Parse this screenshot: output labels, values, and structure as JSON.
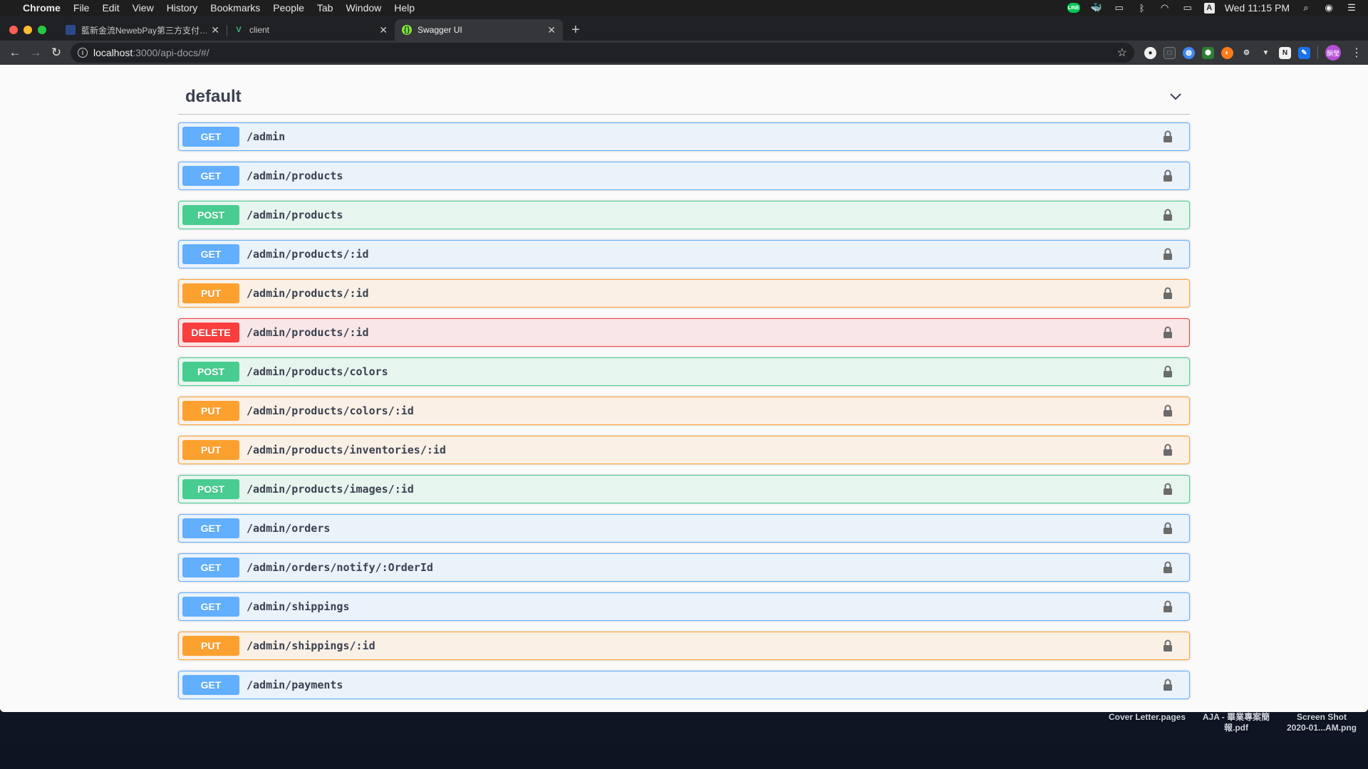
{
  "menubar": {
    "app": "Chrome",
    "items": [
      "File",
      "Edit",
      "View",
      "History",
      "Bookmarks",
      "People",
      "Tab",
      "Window",
      "Help"
    ],
    "clock": "Wed 11:15 PM",
    "line_badge": "LINE",
    "input_source": "A"
  },
  "browser": {
    "tabs": [
      {
        "title": "藍新金流NewebPay第三方支付…",
        "favicon": "bank-icon",
        "active": false
      },
      {
        "title": "client",
        "favicon": "vue-icon",
        "active": false
      },
      {
        "title": "Swagger UI",
        "favicon": "swagger-icon",
        "active": true
      }
    ],
    "url_host": "localhost",
    "url_path": ":3000/api-docs/#/",
    "profile_initials": "韻瑩"
  },
  "swagger": {
    "tag": "default",
    "operations": [
      {
        "method": "GET",
        "path": "/admin"
      },
      {
        "method": "GET",
        "path": "/admin/products"
      },
      {
        "method": "POST",
        "path": "/admin/products"
      },
      {
        "method": "GET",
        "path": "/admin/products/:id"
      },
      {
        "method": "PUT",
        "path": "/admin/products/:id"
      },
      {
        "method": "DELETE",
        "path": "/admin/products/:id"
      },
      {
        "method": "POST",
        "path": "/admin/products/colors"
      },
      {
        "method": "PUT",
        "path": "/admin/products/colors/:id"
      },
      {
        "method": "PUT",
        "path": "/admin/products/inventories/:id"
      },
      {
        "method": "POST",
        "path": "/admin/products/images/:id"
      },
      {
        "method": "GET",
        "path": "/admin/orders"
      },
      {
        "method": "GET",
        "path": "/admin/orders/notify/:OrderId"
      },
      {
        "method": "GET",
        "path": "/admin/shippings"
      },
      {
        "method": "PUT",
        "path": "/admin/shippings/:id"
      },
      {
        "method": "GET",
        "path": "/admin/payments"
      }
    ],
    "colors": {
      "GET": "#61affe",
      "POST": "#49cc90",
      "PUT": "#fca130",
      "DELETE": "#f93e3e"
    }
  },
  "desktop": {
    "files": [
      {
        "line1": "Cover Letter.pages",
        "line2": ""
      },
      {
        "line1": "AJA - 畢業專案簡",
        "line2": "報.pdf"
      },
      {
        "line1": "Screen Shot",
        "line2": "2020-01...AM.png"
      }
    ]
  }
}
